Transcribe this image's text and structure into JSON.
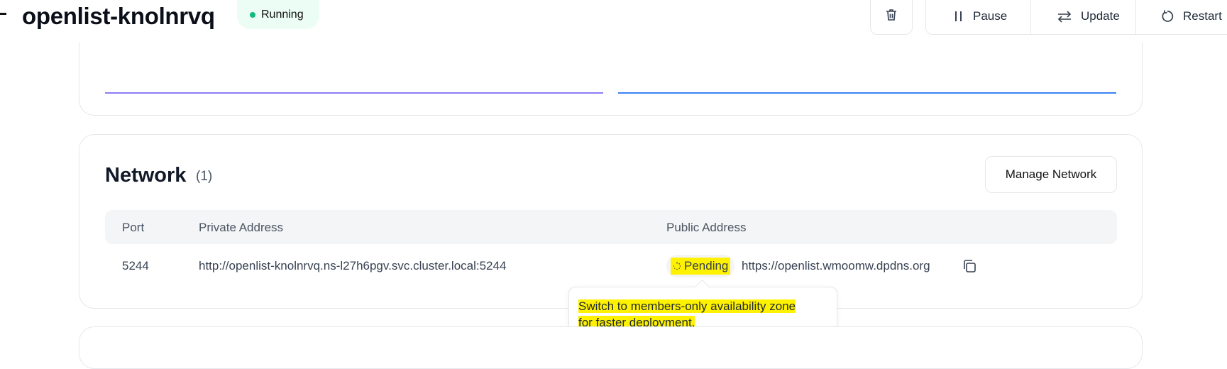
{
  "header": {
    "title": "openlist-knolnrvq",
    "status": "Running",
    "status_color": "#10b981",
    "actions": [
      {
        "label": "Pause",
        "icon": "pause-icon"
      },
      {
        "label": "Update",
        "icon": "swap-icon"
      },
      {
        "label": "Restart",
        "icon": "restart-icon"
      }
    ],
    "delete_icon": "trash-icon"
  },
  "top_card": {
    "line_colors": [
      "#8b7cf6",
      "#3b82f6"
    ]
  },
  "network": {
    "title": "Network",
    "count": "(1)",
    "manage_label": "Manage Network",
    "columns": [
      "Port",
      "Private Address",
      "Public Address"
    ],
    "rows": [
      {
        "port": "5244",
        "private_address": "http://openlist-knolnrvq.ns-l27h6pgv.svc.cluster.local:5244",
        "public_status": "Pending",
        "public_address": "https://openlist.wmoomw.dpdns.org"
      }
    ]
  },
  "tooltip": {
    "line1": "Switch to members-only availability zone",
    "line2": "for faster deployment."
  },
  "highlight_color": "#fff200"
}
